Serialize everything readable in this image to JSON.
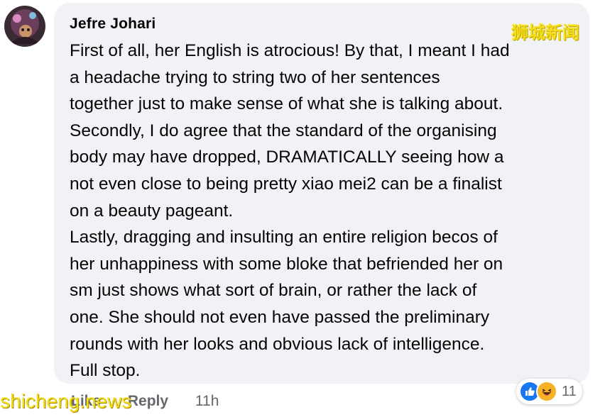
{
  "comment": {
    "author": "Jefre Johari",
    "paragraphs": [
      "First of all, her English is atrocious! By that, I meant I had\na headache trying to string two of her sentences\ntogether just to make sense of what she is talking about.\nSecondly, I do agree that the standard of the organising\nbody may have dropped, DRAMATICALLY seeing how a\nnot even close to being pretty xiao mei2 can be a finalist\non a beauty pageant.",
      "Lastly, dragging and insulting an entire religion becos of\nher unhappiness with some bloke that befriended her on\nsm just shows what sort of brain, or rather the lack of\none. She should not even have passed the preliminary\nrounds with her looks and obvious lack of intelligence.\nFull stop."
    ]
  },
  "actions": {
    "like_label": "Like",
    "reply_label": "Reply",
    "time": "11h"
  },
  "reactions": {
    "icons": [
      "like-icon",
      "haha-icon"
    ],
    "count": "11"
  },
  "watermarks": {
    "top": "狮城新闻",
    "bottom": "shicheng.news"
  },
  "colors": {
    "bubble": "#f0f2f5",
    "like_blue": "#1877f2",
    "haha_yellow": "#f7b125",
    "muted_text": "#65676b",
    "watermark": "#f3dc1a"
  }
}
